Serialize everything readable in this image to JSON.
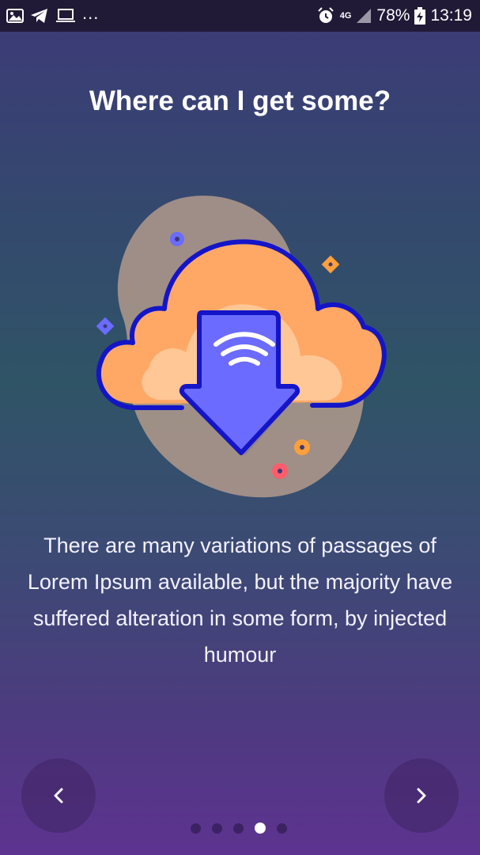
{
  "status_bar": {
    "left_icons": [
      "image-icon",
      "telegram-icon",
      "laptop-icon"
    ],
    "more": "...",
    "network": "4G",
    "battery": "78%",
    "time": "13:19"
  },
  "slide": {
    "title": "Where can I get some?",
    "description": "There are many variations of passages of Lorem Ipsum available, but the majority have suffered alteration in some form, by injected humour"
  },
  "pager": {
    "total": 5,
    "active_index": 3
  },
  "colors": {
    "cloud": "#ffa866",
    "cloud_inner": "#ffc796",
    "outline": "#1414c8",
    "arrow": "#6b6bff",
    "blob": "#c9a792"
  }
}
